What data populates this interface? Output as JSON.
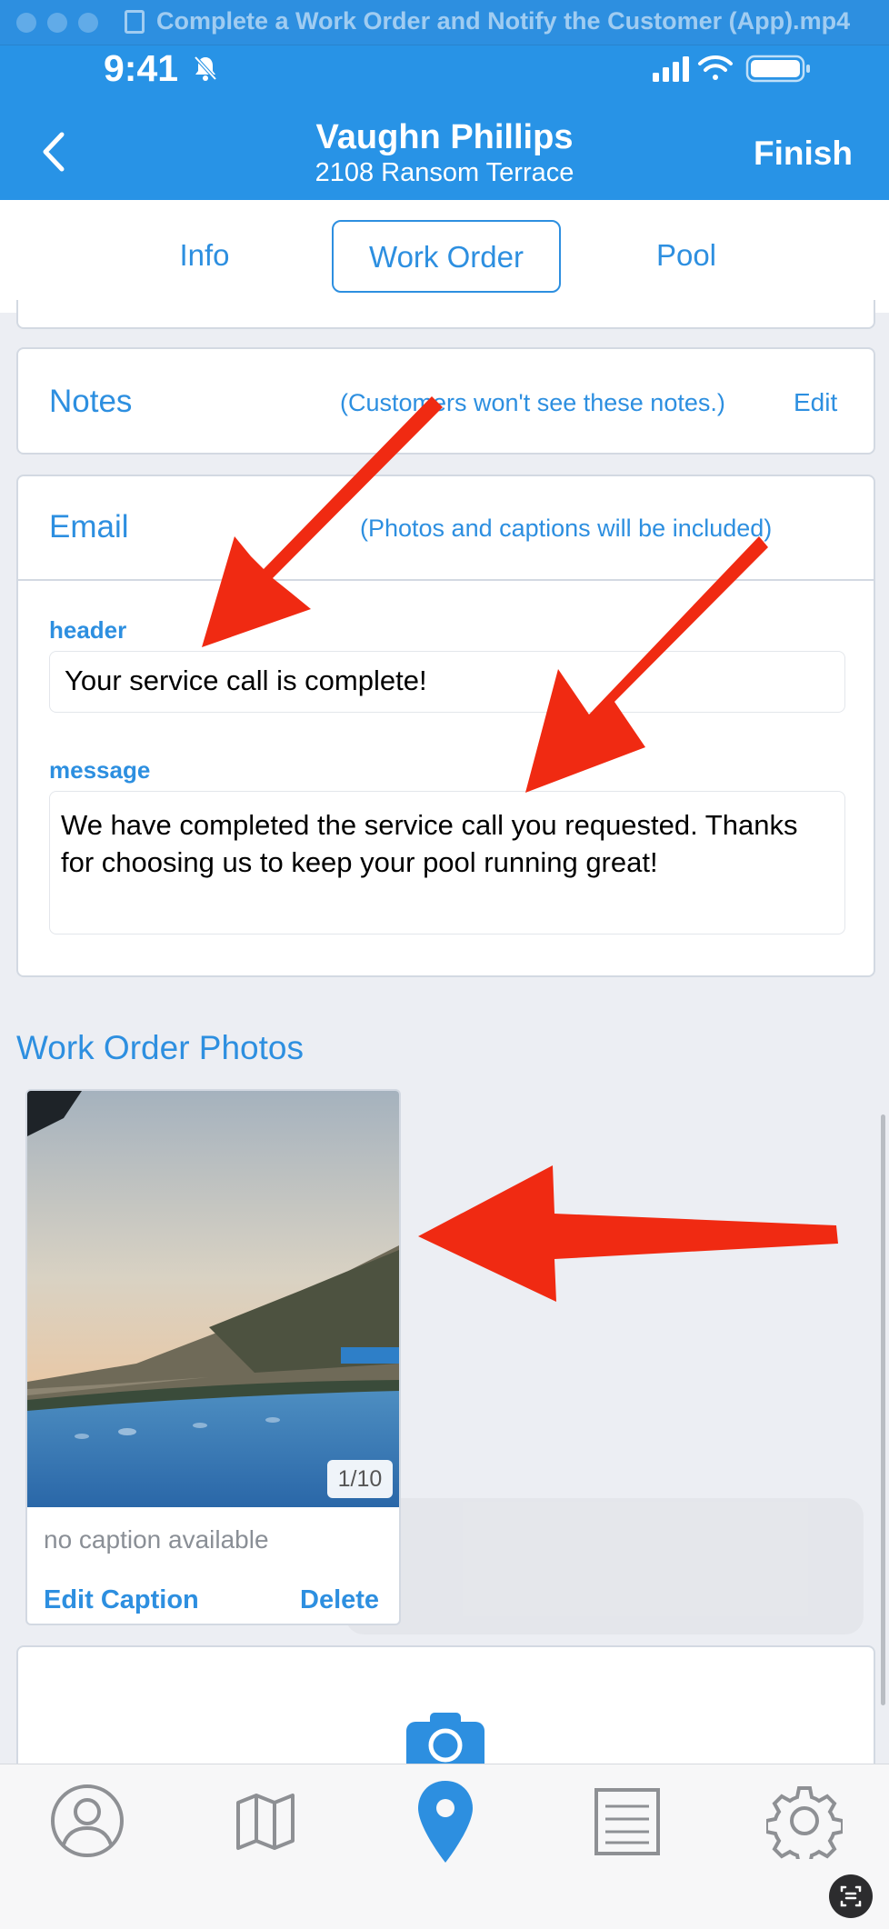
{
  "window": {
    "title": "Complete a Work Order and Notify the Customer (App).mp4"
  },
  "status_bar": {
    "time": "9:41"
  },
  "header": {
    "back_icon": "chevron-left-icon",
    "customer_name": "Vaughn Phillips",
    "address": "2108 Ransom Terrace",
    "finish_label": "Finish"
  },
  "tabs": [
    {
      "label": "Info",
      "active": false
    },
    {
      "label": "Work Order",
      "active": true
    },
    {
      "label": "Pool",
      "active": false
    }
  ],
  "notes": {
    "title": "Notes",
    "hint": "(Customers won't see these notes.)",
    "edit_label": "Edit"
  },
  "email": {
    "title": "Email",
    "hint": "(Photos and captions will be included)",
    "header_label": "header",
    "header_value": "Your service call is complete!",
    "message_label": "message",
    "message_value": "We have completed the service call you requested. Thanks for choosing us to keep your pool running great!"
  },
  "photos": {
    "title": "Work Order Photos",
    "counter": "1/10",
    "caption": "no caption available",
    "edit_caption_label": "Edit Caption",
    "delete_label": "Delete"
  },
  "add_photo_icon": "camera-icon",
  "tab_bar": [
    {
      "icon": "person-icon",
      "active": false
    },
    {
      "icon": "map-icon",
      "active": false
    },
    {
      "icon": "location-pin-icon",
      "active": true
    },
    {
      "icon": "list-icon",
      "active": false
    },
    {
      "icon": "gear-icon",
      "active": false
    }
  ],
  "colors": {
    "accent": "#2D8FE0",
    "header_bg": "#2893E6",
    "annotation_arrow": "#F02A12"
  }
}
